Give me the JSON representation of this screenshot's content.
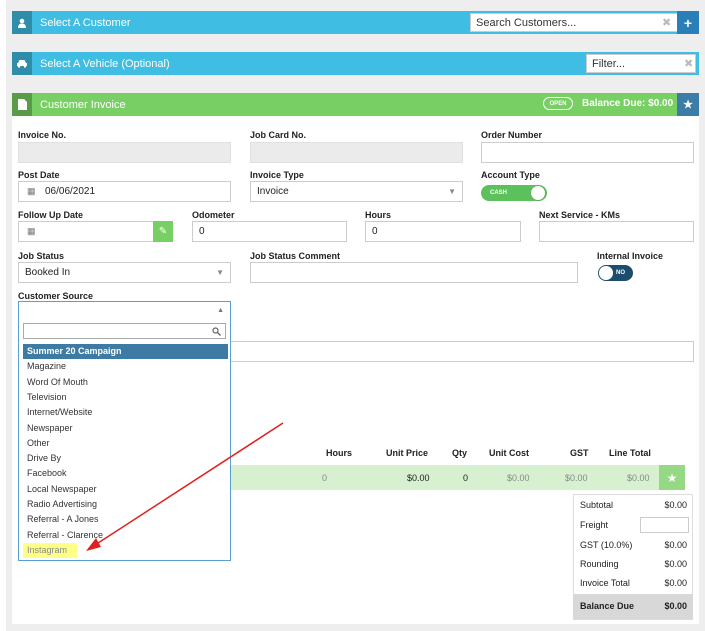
{
  "customer_bar": {
    "title": "Select A Customer",
    "search_value": "Search Customers...",
    "clear": "✖",
    "add": "+"
  },
  "vehicle_bar": {
    "title": "Select A Vehicle (Optional)",
    "filter_value": "Filter...",
    "clear": "✖"
  },
  "invoice_bar": {
    "title": "Customer Invoice",
    "status": "OPEN",
    "balance_due": "Balance Due: $0.00",
    "star": "★"
  },
  "form": {
    "invoice_no_label": "Invoice No.",
    "job_card_label": "Job Card No.",
    "order_number_label": "Order Number",
    "post_date_label": "Post Date",
    "post_date_value": "06/06/2021",
    "invoice_type_label": "Invoice Type",
    "invoice_type_value": "Invoice",
    "account_type_label": "Account Type",
    "account_type_value": "CASH",
    "follow_up_label": "Follow Up Date",
    "odometer_label": "Odometer",
    "odometer_value": "0",
    "hours_label": "Hours",
    "hours_value": "0",
    "next_service_label": "Next Service - KMs",
    "job_status_label": "Job Status",
    "job_status_value": "Booked In",
    "job_status_comment_label": "Job Status Comment",
    "internal_invoice_label": "Internal Invoice",
    "internal_invoice_value": "NO",
    "customer_source_label": "Customer Source"
  },
  "customer_source_options": [
    "Summer 20 Campaign",
    "Magazine",
    "Word Of Mouth",
    "Television",
    "Internet/Website",
    "Newspaper",
    "Other",
    "Drive By",
    "Facebook",
    "Local Newspaper",
    "Radio Advertising",
    "Referral - A Jones",
    "Referral - Clarence",
    "Instagram"
  ],
  "line_table": {
    "headers": {
      "hours": "Hours",
      "unit_price": "Unit Price",
      "qty": "Qty",
      "unit_cost": "Unit Cost",
      "gst": "GST",
      "line_total": "Line Total"
    },
    "row": {
      "hours": "0",
      "unit_price": "$0.00",
      "qty": "0",
      "unit_cost": "$0.00",
      "gst": "$0.00",
      "line_total": "$0.00"
    }
  },
  "totals": {
    "subtotal_label": "Subtotal",
    "subtotal": "$0.00",
    "freight_label": "Freight",
    "gst_label": "GST (10.0%)",
    "gst": "$0.00",
    "rounding_label": "Rounding",
    "rounding": "$0.00",
    "invoice_total_label": "Invoice Total",
    "invoice_total": "$0.00",
    "balance_due_label": "Balance Due",
    "balance_due": "$0.00"
  },
  "colors": {
    "blue_bar": "#3fbde3",
    "green_bar": "#78cf63",
    "selected_option": "#3e7ba4",
    "highlight": "#ffff88",
    "arrow": "#e02020"
  }
}
